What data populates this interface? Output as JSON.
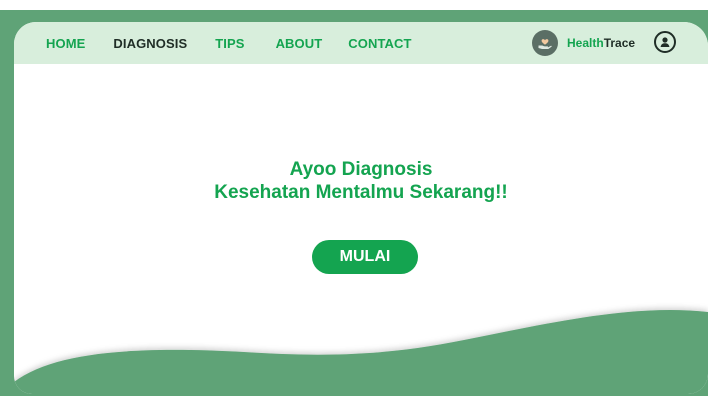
{
  "nav": {
    "items": [
      {
        "label": "HOME"
      },
      {
        "label": "DIAGNOSIS"
      },
      {
        "label": "TIPS"
      },
      {
        "label": "ABOUT"
      },
      {
        "label": "CONTACT"
      }
    ]
  },
  "brand": {
    "name_part1": "Health",
    "name_part2": "Trace",
    "logo_icon": "heart-hand-icon"
  },
  "user": {
    "icon": "user-icon"
  },
  "hero": {
    "line1": "Ayoo Diagnosis",
    "line2": "Kesehatan Mentalmu Sekarang!!"
  },
  "cta": {
    "label": "MULAI"
  },
  "colors": {
    "accent": "#14a450",
    "nav_bg": "#d8eedc",
    "frame_bg": "#5fa377",
    "wave": "#5fa377",
    "dark_text": "#1f2d26"
  }
}
